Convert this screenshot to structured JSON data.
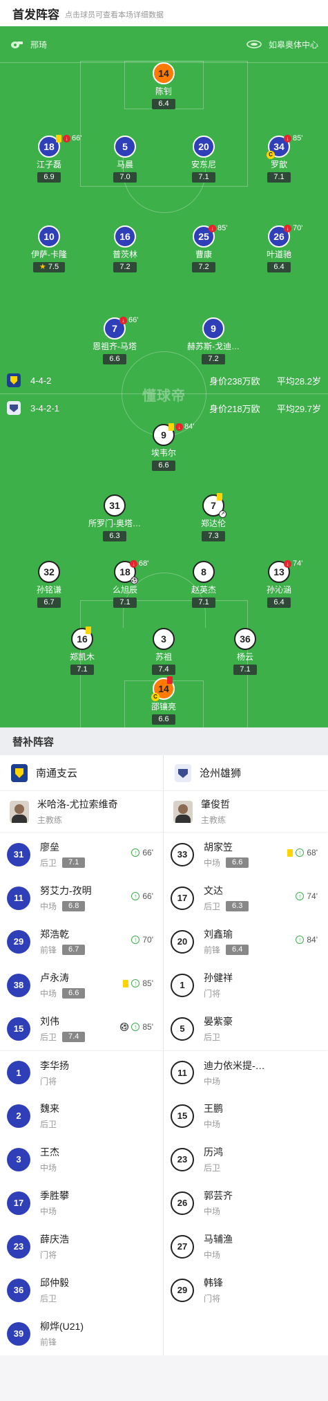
{
  "header": {
    "title": "首发阵容",
    "subtitle": "点击球员可查看本场详细数据"
  },
  "match_info": {
    "referee": "邢琦",
    "stadium": "如皋奥体中心"
  },
  "watermark": "懂球帝",
  "home_team": {
    "name": "南通支云",
    "formation": "4-4-2",
    "value": "身价238万欧",
    "avg_age": "平均28.2岁",
    "color": "#2f3fb8"
  },
  "away_team": {
    "name": "沧州雄狮",
    "formation": "3-4-2-1",
    "value": "身价218万欧",
    "avg_age": "平均29.7岁"
  },
  "home_players": [
    {
      "num": "14",
      "name": "陈钊",
      "rating": "6.4"
    },
    {
      "num": "18",
      "name": "江子磊",
      "rating": "6.9",
      "minute": "66'"
    },
    {
      "num": "5",
      "name": "马晨",
      "rating": "7.0"
    },
    {
      "num": "20",
      "name": "安东尼",
      "rating": "7.1"
    },
    {
      "num": "34",
      "name": "罗歆",
      "rating": "7.1",
      "minute": "85'"
    },
    {
      "num": "10",
      "name": "伊萨-卡隆",
      "rating": "7.5"
    },
    {
      "num": "16",
      "name": "普茨林",
      "rating": "7.2"
    },
    {
      "num": "25",
      "name": "曹康",
      "rating": "7.2",
      "minute": "85'"
    },
    {
      "num": "26",
      "name": "叶道驰",
      "rating": "6.4",
      "minute": "70'"
    },
    {
      "num": "7",
      "name": "恩祖齐-马塔",
      "rating": "6.6",
      "minute": "66'"
    },
    {
      "num": "9",
      "name": "赫苏斯-戈迪…",
      "rating": "7.2"
    }
  ],
  "away_players": [
    {
      "num": "9",
      "name": "埃韦尔",
      "rating": "6.6",
      "minute": "84'"
    },
    {
      "num": "31",
      "name": "所罗门-奥塔…",
      "rating": "6.3"
    },
    {
      "num": "7",
      "name": "郑达伦",
      "rating": "7.3"
    },
    {
      "num": "32",
      "name": "孙铭谦",
      "rating": "6.7"
    },
    {
      "num": "18",
      "name": "么旭辰",
      "rating": "7.1",
      "minute": "68'"
    },
    {
      "num": "8",
      "name": "赵英杰",
      "rating": "7.1"
    },
    {
      "num": "13",
      "name": "孙沁涵",
      "rating": "6.4",
      "minute": "74'"
    },
    {
      "num": "16",
      "name": "郑凯木",
      "rating": "7.1"
    },
    {
      "num": "3",
      "name": "苏祖",
      "rating": "7.4"
    },
    {
      "num": "36",
      "name": "杨云",
      "rating": "7.1"
    },
    {
      "num": "14",
      "name": "邵镶亮",
      "rating": "6.6"
    }
  ],
  "subs": {
    "title": "替补阵容",
    "home": {
      "coach": {
        "name": "米哈洛-尤拉索维奇",
        "role": "主教练"
      },
      "players": [
        {
          "num": "31",
          "name": "廖垒",
          "pos": "后卫",
          "rating": "7.1",
          "minute": "66'"
        },
        {
          "num": "11",
          "name": "努艾力-孜明",
          "pos": "中场",
          "rating": "6.8",
          "minute": "66'"
        },
        {
          "num": "29",
          "name": "郑浩乾",
          "pos": "前锋",
          "rating": "6.7",
          "minute": "70'"
        },
        {
          "num": "38",
          "name": "卢永涛",
          "pos": "中场",
          "rating": "6.6",
          "minute": "85'"
        },
        {
          "num": "15",
          "name": "刘伟",
          "pos": "后卫",
          "rating": "7.4",
          "minute": "85'"
        },
        {
          "num": "1",
          "name": "李华扬",
          "pos": "门将"
        },
        {
          "num": "2",
          "name": "魏来",
          "pos": "后卫"
        },
        {
          "num": "3",
          "name": "王杰",
          "pos": "中场"
        },
        {
          "num": "17",
          "name": "季胜攀",
          "pos": "中场"
        },
        {
          "num": "23",
          "name": "薛庆浩",
          "pos": "门将"
        },
        {
          "num": "36",
          "name": "邱仲毅",
          "pos": "后卫"
        },
        {
          "num": "39",
          "name": "柳烨(U21)",
          "pos": "前锋"
        }
      ]
    },
    "away": {
      "coach": {
        "name": "肇俊哲",
        "role": "主教练"
      },
      "players": [
        {
          "num": "33",
          "name": "胡家笠",
          "pos": "中场",
          "rating": "6.6",
          "minute": "68'"
        },
        {
          "num": "17",
          "name": "文达",
          "pos": "后卫",
          "rating": "6.3",
          "minute": "74'"
        },
        {
          "num": "20",
          "name": "刘鑫瑜",
          "pos": "前锋",
          "rating": "6.4",
          "minute": "84'"
        },
        {
          "num": "1",
          "name": "孙健祥",
          "pos": "门将"
        },
        {
          "num": "5",
          "name": "晏紫豪",
          "pos": "后卫"
        },
        {
          "num": "11",
          "name": "迪力依米提-…",
          "pos": "中场"
        },
        {
          "num": "15",
          "name": "王鹏",
          "pos": "中场"
        },
        {
          "num": "23",
          "name": "历鸿",
          "pos": "后卫"
        },
        {
          "num": "26",
          "name": "郭芸齐",
          "pos": "中场"
        },
        {
          "num": "27",
          "name": "马辅渔",
          "pos": "中场"
        },
        {
          "num": "29",
          "name": "韩锋",
          "pos": "门将"
        }
      ]
    }
  }
}
